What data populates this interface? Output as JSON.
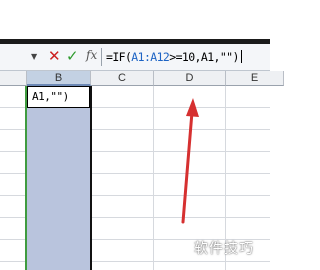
{
  "formula_bar": {
    "dropdown_arrow": "▼",
    "cancel_symbol": "✕",
    "enter_symbol": "✓",
    "fx_label": "fx",
    "formula_prefix": "=IF(",
    "formula_ref": "A1:A12",
    "formula_suffix": ">=10,A1,\"\")"
  },
  "columns": [
    "B",
    "C",
    "D",
    "E"
  ],
  "selected_column": "B",
  "cell_B1_text": "A1,\"\")",
  "annotation": {
    "type": "arrow",
    "color": "#d63030"
  },
  "watermark": "软件技巧",
  "colors": {
    "selection": "#b9c4dd",
    "cancel": "#cc1f1f",
    "enter": "#2e9b2e",
    "arrow": "#d63030"
  }
}
